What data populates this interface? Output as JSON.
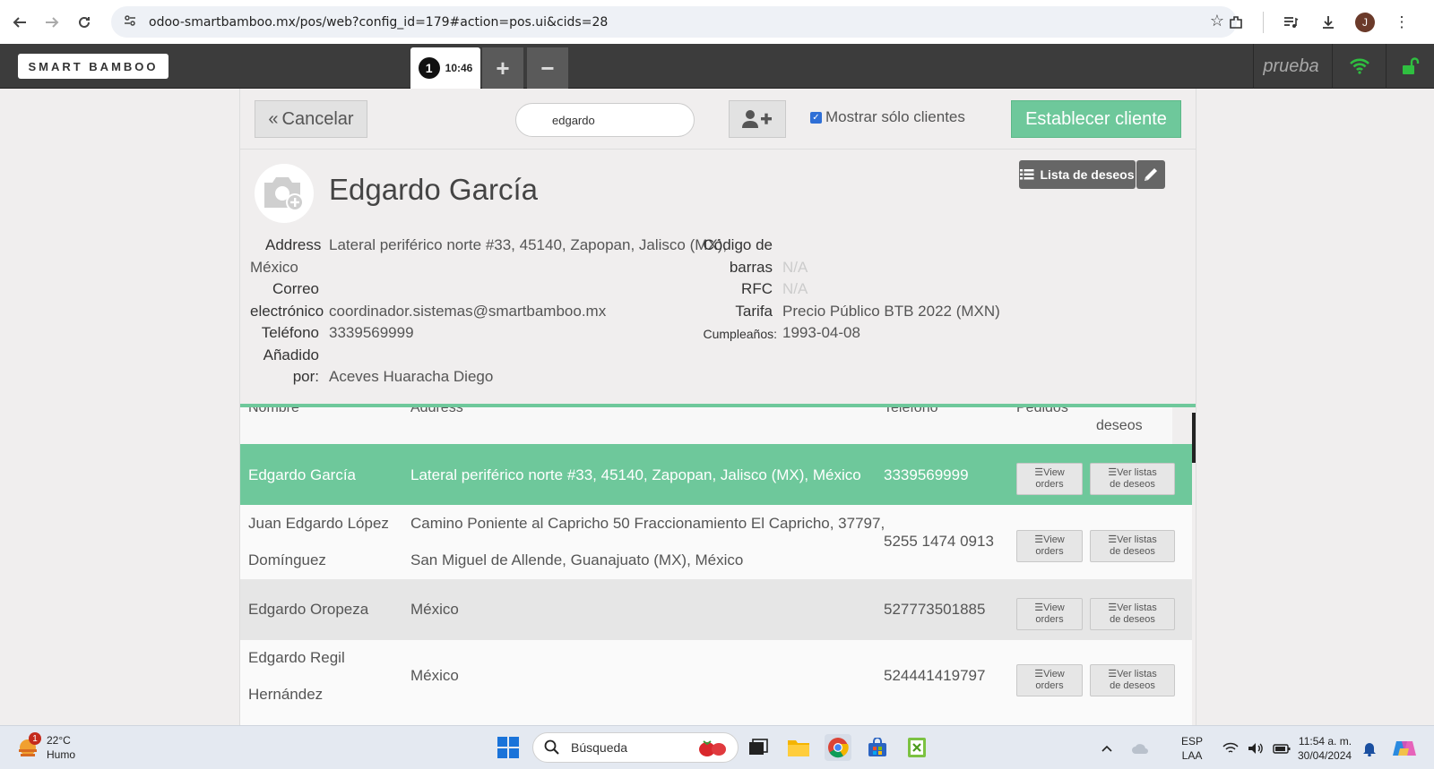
{
  "browser": {
    "url": "odoo-smartbamboo.mx/pos/web?config_id=179#action=pos.ui&cids=28",
    "profile_initial": "J"
  },
  "pos_bar": {
    "logo": "SMART BAMBOO",
    "order_number": "1",
    "order_time": "10:46",
    "add_label": "+",
    "remove_label": "−",
    "user_label": "prueba"
  },
  "controls": {
    "cancel_label": "Cancelar",
    "search_value": "edgardo",
    "only_clients_label": "Mostrar sólo clientes",
    "only_clients_checked": true,
    "set_client_label": "Establecer cliente"
  },
  "client": {
    "name": "Edgardo García",
    "wishlist_label": "Lista de deseos",
    "fields": {
      "address_label": "Address",
      "address_value_line1": "Lateral periférico norte #33, 45140, Zapopan, Jalisco (MX),",
      "address_value_line2": "México",
      "email_label_line1": "Correo",
      "email_label_line2": "electrónico",
      "email_value": "coordinador.sistemas@smartbamboo.mx",
      "phone_label": "Teléfono",
      "phone_value": "3339569999",
      "added_label_line1": "Añadido",
      "added_label_line2": "por:",
      "added_value": "Aceves Huaracha Diego",
      "barcode_label_line1": "Código de",
      "barcode_label_line2": "barras",
      "barcode_value": "N/A",
      "rfc_label": "RFC",
      "rfc_value": "N/A",
      "pricelist_label": "Tarifa",
      "pricelist_value": "Precio Público BTB 2022 (MXN)",
      "birthday_label": "Cumpleaños:",
      "birthday_value": "1993-04-08"
    }
  },
  "table": {
    "headers": {
      "name": "Nombre",
      "address": "Address",
      "phone": "Teléfono",
      "orders": "Pedidos",
      "wishlists": "deseos"
    },
    "view_orders_line1": "View",
    "view_orders_line2": "orders",
    "wishlists_line1": "Ver listas",
    "wishlists_line2": "de deseos",
    "rows": [
      {
        "name_line1": "Edgardo García",
        "name_line2": "",
        "address_line1": "Lateral periférico norte #33, 45140, Zapopan, Jalisco (MX), México",
        "address_line2": "",
        "phone": "3339569999"
      },
      {
        "name_line1": "Juan Edgardo López",
        "name_line2": "Domínguez",
        "address_line1": "Camino Poniente al Capricho 50 Fraccionamiento El Capricho, 37797,",
        "address_line2": "San Miguel de Allende, Guanajuato (MX), México",
        "phone": "5255 1474 0913"
      },
      {
        "name_line1": "Edgardo Oropeza",
        "name_line2": "",
        "address_line1": "México",
        "address_line2": "",
        "phone": "527773501885"
      },
      {
        "name_line1": "Edgardo Regil",
        "name_line2": "Hernández",
        "address_line1": "México",
        "address_line2": "",
        "phone": "524441419797"
      }
    ]
  },
  "taskbar": {
    "weather_badge": "1",
    "temperature": "22°C",
    "weather_desc": "Humo",
    "search_label": "Búsqueda",
    "lang_line1": "ESP",
    "lang_line2": "LAA",
    "time": "11:54 a. m.",
    "date": "30/04/2024"
  },
  "colors": {
    "accent_green": "#6ec89b",
    "pos_bar": "#3c3c3c",
    "wifi_green": "#2fbf40"
  }
}
